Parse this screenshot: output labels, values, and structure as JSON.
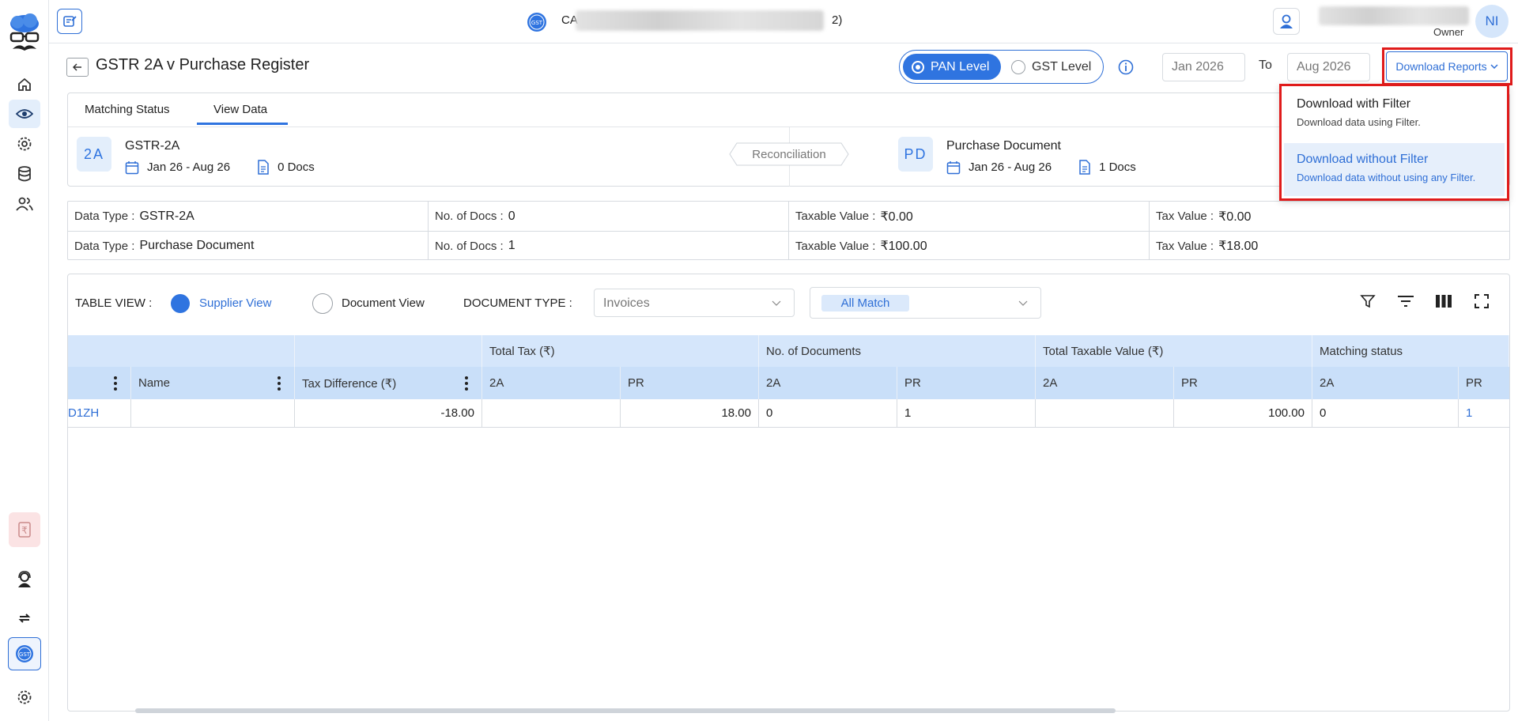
{
  "topbar": {
    "org_prefix": "CA",
    "org_suffix": "2)",
    "user_initials": "NI",
    "user_role": "Owner"
  },
  "header": {
    "title": "GSTR 2A v Purchase Register",
    "pan_level_label": "PAN Level",
    "gst_level_label": "GST Level",
    "date_from": "Jan  2026",
    "to_label": "To",
    "date_to": "Aug 2026",
    "download_button": "Download Reports"
  },
  "download_menu": {
    "items": [
      {
        "title": "Download with Filter",
        "subtitle": "Download data using Filter."
      },
      {
        "title": "Download without Filter",
        "subtitle": "Download data without using any Filter."
      }
    ]
  },
  "tabs": [
    "Matching Status",
    "View Data"
  ],
  "sources": {
    "left": {
      "badge": "2A",
      "title": "GSTR-2A",
      "period": "Jan 26 - Aug 26",
      "docs": "0 Docs"
    },
    "middle": "Reconciliation",
    "right": {
      "badge": "PD",
      "title": "Purchase Document",
      "period": "Jan 26 - Aug 26",
      "docs": "1 Docs"
    }
  },
  "summary": {
    "rows": [
      {
        "data_type_label": "Data Type :",
        "data_type": "GSTR-2A",
        "docs_label": "No. of Docs :",
        "docs": "0",
        "taxable_label": "Taxable Value :",
        "taxable": "₹0.00",
        "tax_label": "Tax Value :",
        "tax": "₹0.00"
      },
      {
        "data_type_label": "Data Type :",
        "data_type": "Purchase Document",
        "docs_label": "No. of Docs :",
        "docs": "1",
        "taxable_label": "Taxable Value :",
        "taxable": "₹100.00",
        "tax_label": "Tax Value :",
        "tax": "₹18.00"
      }
    ]
  },
  "table_controls": {
    "table_view_label": "TABLE VIEW :",
    "supplier_view": "Supplier View",
    "document_view": "Document View",
    "doc_type_label": "DOCUMENT TYPE :",
    "doc_type_placeholder": "Invoices",
    "match_filter": "All Match"
  },
  "grid": {
    "group_headers": [
      "Total Tax (₹)",
      "No. of Documents",
      "Total Taxable Value (₹)",
      "Matching status"
    ],
    "sub_headers": {
      "name": "Name",
      "tax_diff": "Tax Difference (₹)",
      "a1": "2A",
      "p1": "PR",
      "a2": "2A",
      "p2": "PR",
      "a3": "2A",
      "p3": "PR",
      "a4": "2A",
      "p4": "PR"
    },
    "rows": [
      {
        "gstin_tail": "D1ZH",
        "name": "",
        "tax_diff": "-18.00",
        "tax_2a": "",
        "tax_pr": "18.00",
        "docs_2a": "0",
        "docs_pr": "1",
        "taxable_2a": "",
        "taxable_pr": "100.00",
        "match_2a": "0",
        "match_pr": "1"
      }
    ]
  },
  "colors": {
    "accent": "#2f74e0",
    "highlight": "#e01b1b",
    "header_bg": "#d5e6fb"
  }
}
